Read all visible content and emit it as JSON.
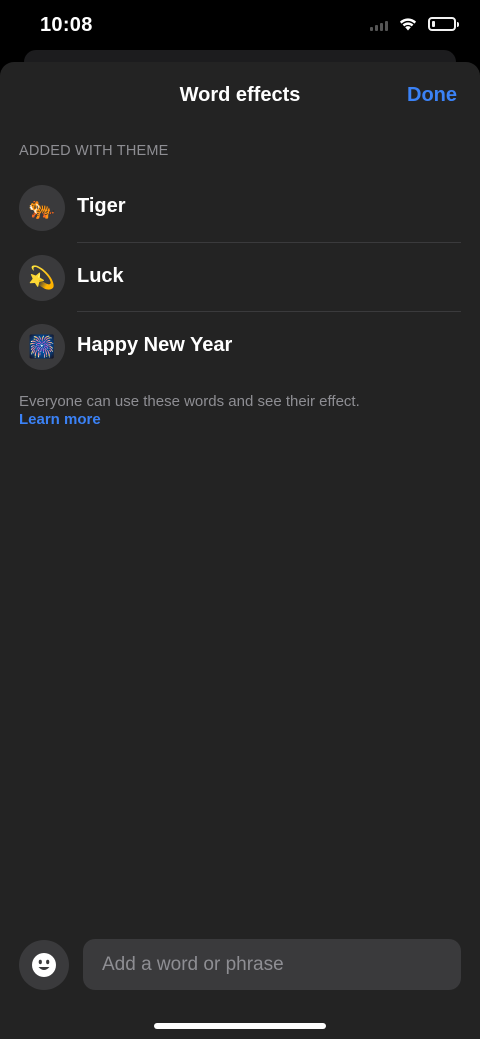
{
  "status_bar": {
    "time": "10:08",
    "signal_icon": "cellular-signal-icon",
    "wifi_icon": "wifi-icon",
    "battery_icon": "battery-low-icon",
    "battery_level": 0.15
  },
  "sheet": {
    "title": "Word effects",
    "done_label": "Done",
    "section_header": "ADDED WITH THEME",
    "items": [
      {
        "label": "Tiger",
        "emoji": "🐅",
        "icon": "tiger-icon"
      },
      {
        "label": "Luck",
        "emoji": "💫",
        "icon": "dizzy-star-icon"
      },
      {
        "label": "Happy New Year",
        "emoji": "🎆",
        "icon": "fireworks-icon"
      }
    ],
    "footer_note": "Everyone can use these words and see their effect.",
    "learn_more_label": "Learn more"
  },
  "composer": {
    "emoji_button_icon": "smiley-face-icon",
    "input_placeholder": "Add a word or phrase",
    "input_value": ""
  },
  "colors": {
    "background": "#000000",
    "sheet": "#232323",
    "accent": "#3b82f6",
    "secondary_text": "#8e8e93",
    "control_fill": "#3a3a3c"
  }
}
